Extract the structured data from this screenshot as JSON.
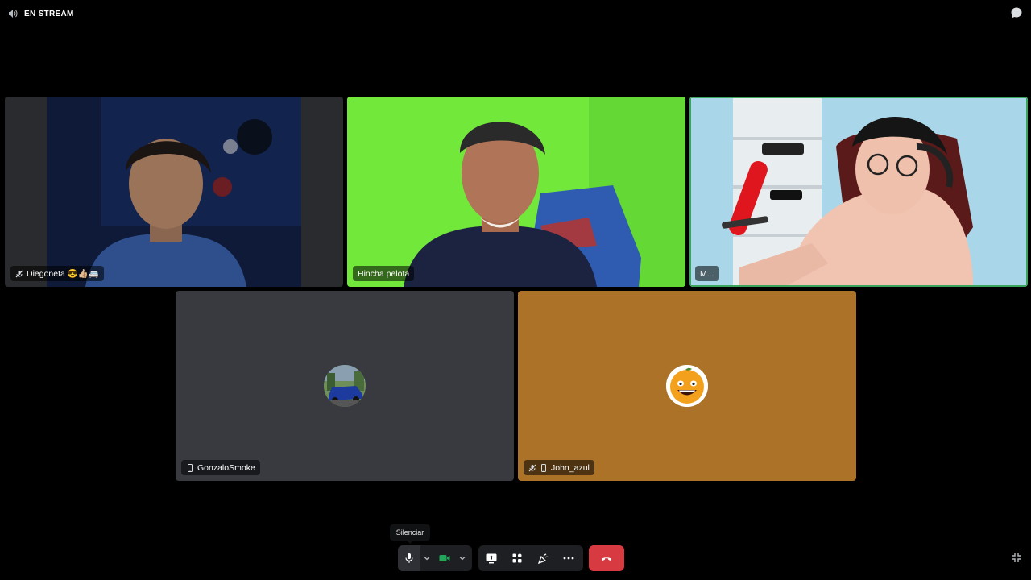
{
  "header": {
    "title": "EN STREAM",
    "icon": "speaker-icon"
  },
  "participants": [
    {
      "name": "Diegoneta 😎👍🏼🚐",
      "icons": [
        "mic-muted-icon"
      ]
    },
    {
      "name": "Hincha pelota",
      "icons": []
    },
    {
      "name": "M...",
      "icons": []
    },
    {
      "name": "GonzaloSmoke",
      "icons": [
        "mobile-icon"
      ],
      "tile_color": "#383a40"
    },
    {
      "name": "John_azul",
      "icons": [
        "mic-muted-icon",
        "mobile-icon"
      ],
      "tile_color": "#ac7228"
    }
  ],
  "tooltip": {
    "text": "Silenciar"
  },
  "controls": {
    "mic": "mic-icon",
    "camera": "camera-icon",
    "screen_share": "screen-share-icon",
    "activities": "activities-icon",
    "soundboard": "soundboard-icon",
    "more": "more-icon",
    "leave": "leave-call-icon"
  },
  "colors": {
    "accent_green": "#23a55a",
    "leave_red": "#d83a42",
    "speaking_border": "#3ba55d"
  }
}
